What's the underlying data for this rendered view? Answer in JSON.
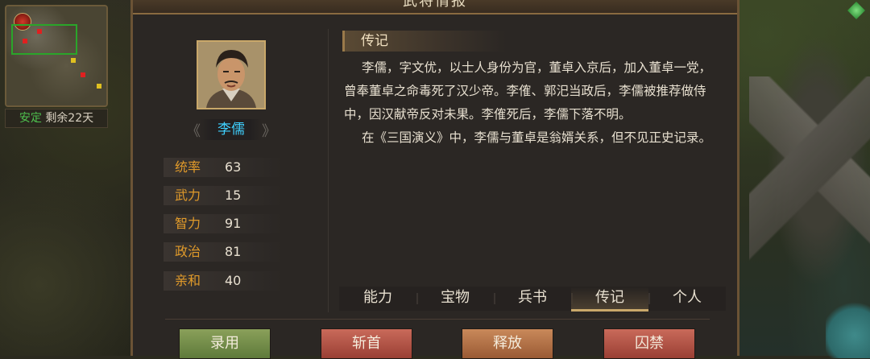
{
  "window": {
    "title": "武将情报"
  },
  "minimap": {
    "status_label": "安定",
    "status_remaining": "剩余22天"
  },
  "general": {
    "name": "李儒",
    "prev_arrow": "《",
    "next_arrow": "》",
    "stats": [
      {
        "label": "统率",
        "value": "63"
      },
      {
        "label": "武力",
        "value": "15"
      },
      {
        "label": "智力",
        "value": "91"
      },
      {
        "label": "政治",
        "value": "81"
      },
      {
        "label": "亲和",
        "value": "40"
      }
    ]
  },
  "biography": {
    "title": "传记",
    "paragraphs": [
      "李儒，字文优，以士人身份为官，董卓入京后，加入董卓一党，曾奉董卓之命毒死了汉少帝。李傕、郭汜当政后，李儒被推荐做侍中，因汉献帝反对未果。李傕死后，李儒下落不明。",
      "在《三国演义》中，李儒与董卓是翁婿关系，但不见正史记录。"
    ]
  },
  "tabs": [
    {
      "label": "能力",
      "active": false
    },
    {
      "label": "宝物",
      "active": false
    },
    {
      "label": "兵书",
      "active": false
    },
    {
      "label": "传记",
      "active": true
    },
    {
      "label": "个人",
      "active": false
    }
  ],
  "actions": {
    "recruit": "录用",
    "behead": "斩首",
    "release": "释放",
    "imprison": "囚禁"
  },
  "colors": {
    "name": "#3fd0ff",
    "stat_label": "#e09a2a",
    "status_green": "#4ec04e"
  }
}
